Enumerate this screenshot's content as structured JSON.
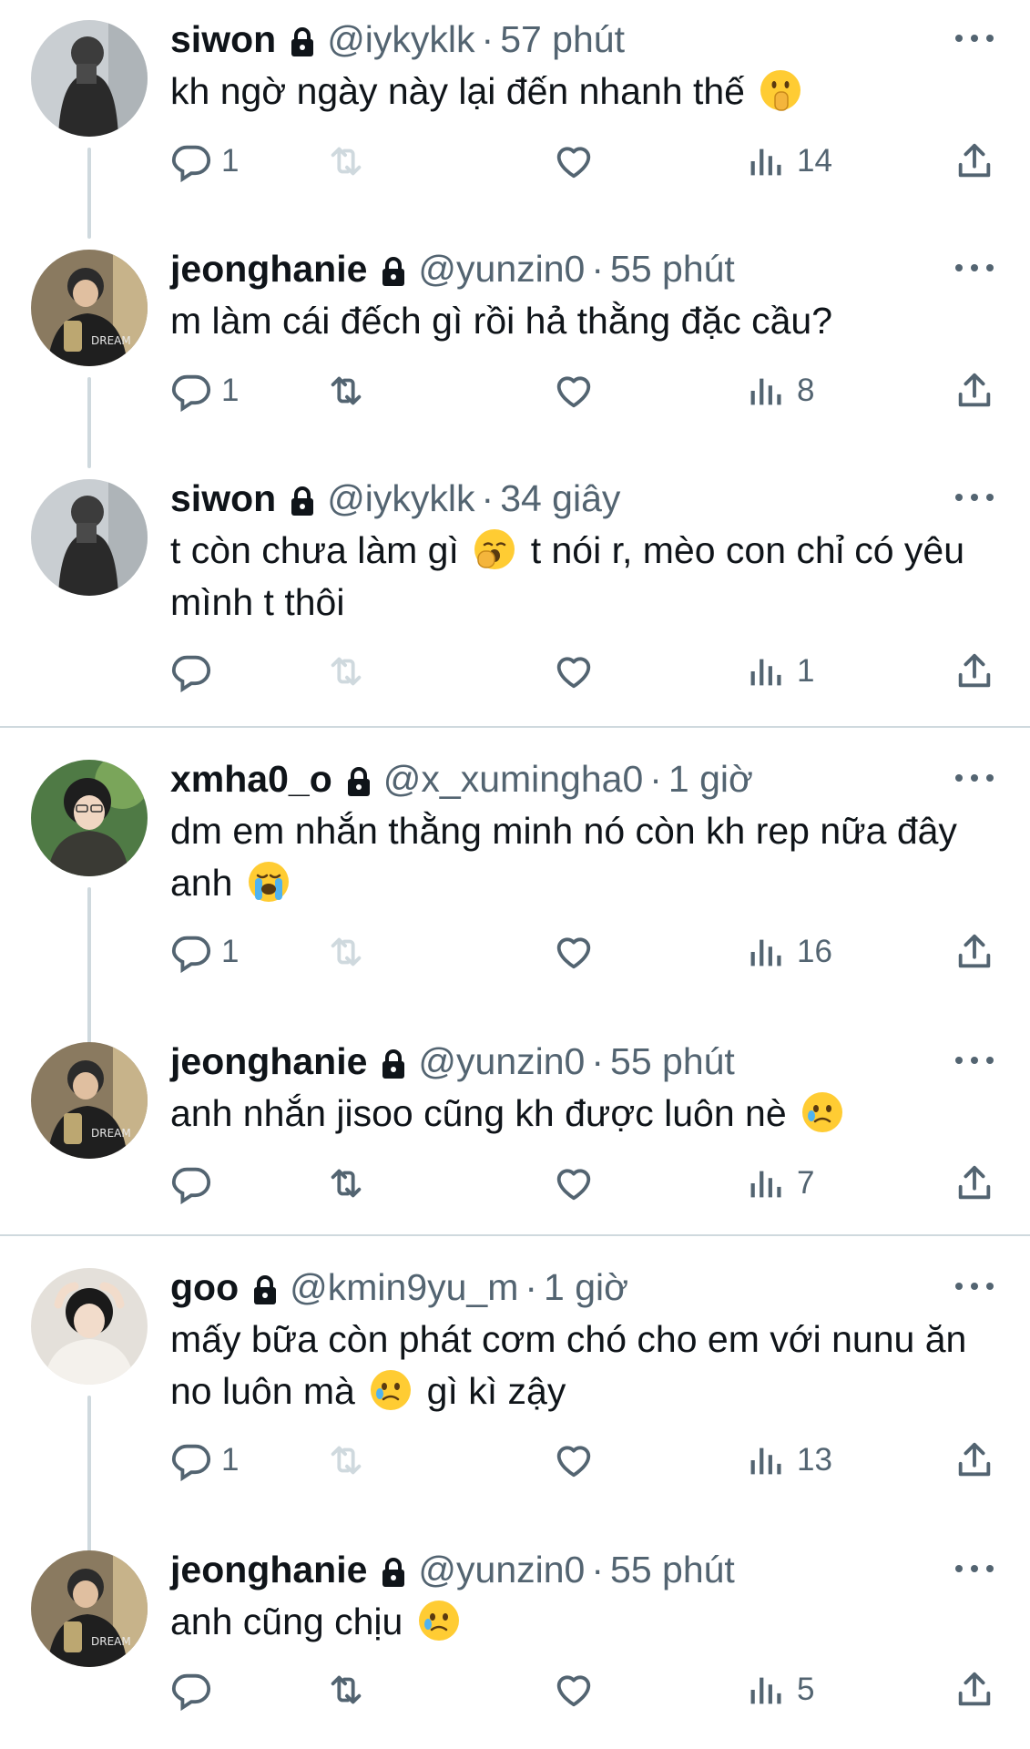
{
  "tweets": [
    {
      "name": "siwon",
      "handle": "@iykyklk",
      "sep": "·",
      "time": "57 phút",
      "text_parts": [
        "kh ngờ ngày này lại đến nhanh thế"
      ],
      "emoji": "shushing-face",
      "replies": "1",
      "views": "14",
      "retweet_disabled": true
    },
    {
      "name": "jeonghanie",
      "handle": "@yunzin0",
      "sep": "·",
      "time": "55 phút",
      "text_parts": [
        "m làm cái đếch gì rồi hả thằng đặc cầu?"
      ],
      "replies": "1",
      "views": "8",
      "retweet_disabled": false
    },
    {
      "name": "siwon",
      "handle": "@iykyklk",
      "sep": "·",
      "time": "34 giây",
      "text_parts": [
        "t còn chưa làm gì",
        "t nói r, mèo con chỉ có yêu mình t thôi"
      ],
      "emoji": "yawning-face",
      "replies": "",
      "views": "1",
      "retweet_disabled": true
    },
    {
      "name": "xmha0_o",
      "handle": "@x_xumingha0",
      "sep": "·",
      "time": "1 giờ",
      "text_parts": [
        "dm em nhắn thằng minh nó còn kh rep nữa đây anh"
      ],
      "emoji": "loudly-crying-face",
      "replies": "1",
      "views": "16",
      "retweet_disabled": true
    },
    {
      "name": "jeonghanie",
      "handle": "@yunzin0",
      "sep": "·",
      "time": "55 phút",
      "text_parts": [
        "anh nhắn jisoo cũng kh được luôn nè"
      ],
      "emoji": "face-holding-back-tears",
      "replies": "",
      "views": "7",
      "retweet_disabled": false
    },
    {
      "name": "goo",
      "handle": "@kmin9yu_m",
      "sep": "·",
      "time": "1 giờ",
      "text_parts": [
        "mấy bữa còn phát cơm chó cho em với nunu ăn no luôn mà",
        "gì kì zậy"
      ],
      "emoji": "face-holding-back-tears",
      "replies": "1",
      "views": "13",
      "retweet_disabled": true
    },
    {
      "name": "jeonghanie",
      "handle": "@yunzin0",
      "sep": "·",
      "time": "55 phút",
      "text_parts": [
        "anh cũng chịu"
      ],
      "emoji": "face-holding-back-tears",
      "replies": "",
      "views": "5",
      "retweet_disabled": false
    }
  ],
  "colors": {
    "text": "#0f1419",
    "secondary": "#536471",
    "disabled": "#cfd9de",
    "line": "#cfd9de"
  },
  "icons": [
    "reply-icon",
    "retweet-icon",
    "like-icon",
    "views-icon",
    "share-icon",
    "lock-icon",
    "more-icon"
  ]
}
